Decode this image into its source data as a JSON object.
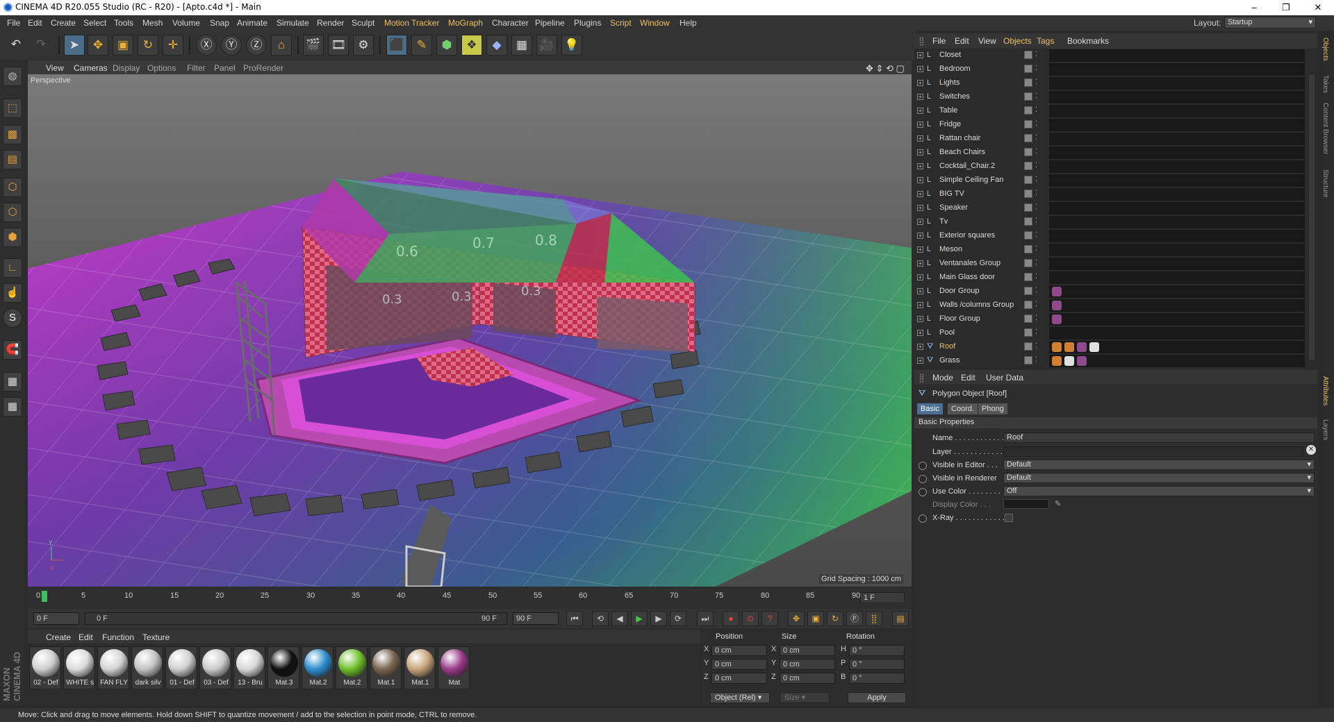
{
  "window": {
    "title": "CINEMA 4D R20.055 Studio (RC - R20) - [Apto.c4d *] - Main",
    "minimize": "–",
    "maximize": "❐",
    "close": "✕"
  },
  "menu": [
    "File",
    "Edit",
    "Create",
    "Select",
    "Tools",
    "Mesh",
    "Volume",
    "Snap",
    "Animate",
    "Simulate",
    "Render",
    "Sculpt",
    "Motion Tracker",
    "MoGraph",
    "Character",
    "Pipeline",
    "Plugins",
    "Script",
    "Window",
    "Help"
  ],
  "layout": {
    "label": "Layout:",
    "value": "Startup"
  },
  "viewport": {
    "menu": [
      "View",
      "Cameras",
      "Display",
      "Options",
      "Filter",
      "Panel",
      "ProRender"
    ],
    "label": "Perspective",
    "grid_spacing": "Grid Spacing : 1000 cm",
    "roof_labels": [
      "0.6",
      "0.7",
      "0.8",
      "0.3",
      "0.3",
      "0.3"
    ]
  },
  "timeline": {
    "ticks": [
      "0",
      "5",
      "10",
      "15",
      "20",
      "25",
      "30",
      "35",
      "40",
      "45",
      "50",
      "55",
      "60",
      "65",
      "70",
      "75",
      "80",
      "85",
      "90"
    ],
    "current_frame": "1 F",
    "start": "0 F",
    "range_start": "0 F",
    "range_end": "90 F",
    "end": "90 F"
  },
  "material_manager": {
    "menu": [
      "Create",
      "Edit",
      "Function",
      "Texture"
    ],
    "materials": [
      {
        "label": "02 - Def",
        "color": "#cfcfcf"
      },
      {
        "label": "WHITE s",
        "color": "#dcdcdc"
      },
      {
        "label": "FAN FLY",
        "color": "#d5d5d5"
      },
      {
        "label": "dark silv",
        "color": "#c4c4c4"
      },
      {
        "label": "01 - Def",
        "color": "#d0d0d0"
      },
      {
        "label": "03 - Def",
        "color": "#cccccc"
      },
      {
        "label": "13 - Bru",
        "color": "#d8d8d8"
      },
      {
        "label": "Mat.3",
        "color": "#111111"
      },
      {
        "label": "Mat.2",
        "color": "#2e8fcf"
      },
      {
        "label": "Mat.2",
        "color": "#6fc02c"
      },
      {
        "label": "Mat.1",
        "color": "#7a6651"
      },
      {
        "label": "Mat.1",
        "color": "#c8a67c"
      },
      {
        "label": "Mat",
        "color": "#9a3c8a"
      }
    ]
  },
  "coordinates": {
    "headers": [
      "Position",
      "Size",
      "Rotation"
    ],
    "rows": [
      {
        "axis": "X",
        "pos": "0 cm",
        "saxis": "X",
        "size": "0 cm",
        "raxis": "H",
        "rot": "0 °"
      },
      {
        "axis": "Y",
        "pos": "0 cm",
        "saxis": "Y",
        "size": "0 cm",
        "raxis": "P",
        "rot": "0 °"
      },
      {
        "axis": "Z",
        "pos": "0 cm",
        "saxis": "Z",
        "size": "0 cm",
        "raxis": "B",
        "rot": "0 °"
      }
    ],
    "mode": "Object (Rel)",
    "size_mode": "Size",
    "apply": "Apply"
  },
  "status": "Move: Click and drag to move elements. Hold down SHIFT to quantize movement / add to the selection in point mode, CTRL to remove.",
  "object_manager": {
    "menu": [
      "File",
      "Edit",
      "View",
      "Objects",
      "Tags",
      "Bookmarks"
    ],
    "objects": [
      {
        "name": "Closet",
        "tags": []
      },
      {
        "name": "Bedroom",
        "tags": []
      },
      {
        "name": "Lights",
        "tags": []
      },
      {
        "name": "Switches",
        "tags": []
      },
      {
        "name": "Table",
        "tags": []
      },
      {
        "name": "Fridge",
        "tags": []
      },
      {
        "name": "Rattan chair",
        "tags": []
      },
      {
        "name": "Beach Chairs",
        "tags": []
      },
      {
        "name": "Cocktail_Chair.2",
        "tags": []
      },
      {
        "name": "Simple Ceiling Fan",
        "tags": []
      },
      {
        "name": "BIG TV",
        "tags": []
      },
      {
        "name": "Speaker",
        "tags": []
      },
      {
        "name": "Tv",
        "tags": []
      },
      {
        "name": "Exterior squares",
        "tags": []
      },
      {
        "name": "Meson",
        "tags": []
      },
      {
        "name": "Ventanales Group",
        "tags": []
      },
      {
        "name": "Main Glass door",
        "tags": []
      },
      {
        "name": "Door Group",
        "tags": [
          "#8e4a8a"
        ]
      },
      {
        "name": "Walls /columns Group",
        "tags": [
          "#8e4a8a"
        ]
      },
      {
        "name": "Floor Group",
        "tags": [
          "#8e4a8a"
        ]
      },
      {
        "name": "Pool",
        "tags": []
      },
      {
        "name": "Roof",
        "tags": [
          "#d08030",
          "#d08030",
          "#8e4a8a",
          "#e0e0e0"
        ]
      },
      {
        "name": "Grass",
        "tags": [
          "#d08030",
          "#e0e0e0",
          "#8e4a8a"
        ]
      }
    ],
    "selected": "Roof"
  },
  "attributes": {
    "menu": [
      "Mode",
      "Edit",
      "User Data"
    ],
    "object_title": "Polygon Object [Roof]",
    "tabs": [
      "Basic",
      "Coord.",
      "Phong"
    ],
    "section": "Basic Properties",
    "props": [
      {
        "label": "Name . . . . . . . . . . . .",
        "value": "Roof"
      },
      {
        "label": "Layer . . . . . . . . . . . .",
        "value": ""
      },
      {
        "label": "Visible in Editor . . .",
        "value": "Default"
      },
      {
        "label": "Visible in Renderer",
        "value": "Default"
      },
      {
        "label": "Use Color . . . . . . . .",
        "value": "Off"
      },
      {
        "label": "Display Color . . .",
        "value": ""
      },
      {
        "label": "X-Ray . . . . . . . . . . . .",
        "value": ""
      }
    ]
  },
  "side_tabs": [
    "Objects",
    "Takes",
    "Content Browser",
    "Structure",
    "Attributes",
    "Layers"
  ],
  "maxon": "MAXON CINEMA 4D"
}
